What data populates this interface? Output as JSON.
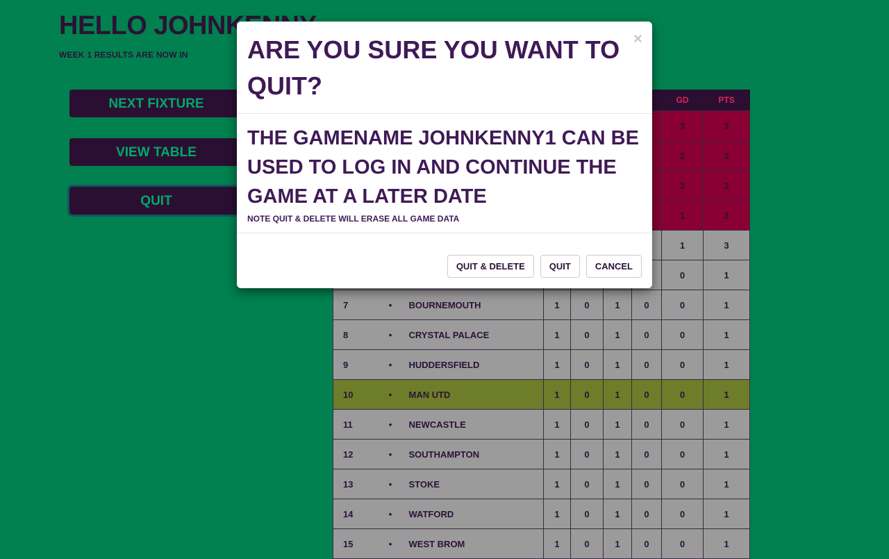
{
  "header": {
    "greeting": "HELLO JOHNKENNY",
    "subtitle": "WEEK 1 RESULTS ARE NOW IN"
  },
  "menu": {
    "next_fixture": "NEXT FIXTURE",
    "view_table": "VIEW TABLE",
    "quit": "QUIT"
  },
  "table": {
    "visible_headers": [
      "GD",
      "PTS"
    ],
    "rows": [
      {
        "pos": "",
        "dot": "",
        "team": "",
        "p": "",
        "w": "",
        "d": "",
        "l": "",
        "gd": "3",
        "pts": "3",
        "style": "top"
      },
      {
        "pos": "",
        "dot": "",
        "team": "",
        "p": "",
        "w": "",
        "d": "",
        "l": "",
        "gd": "2",
        "pts": "3",
        "style": "top"
      },
      {
        "pos": "",
        "dot": "",
        "team": "",
        "p": "",
        "w": "",
        "d": "",
        "l": "",
        "gd": "2",
        "pts": "3",
        "style": "top"
      },
      {
        "pos": "",
        "dot": "",
        "team": "",
        "p": "",
        "w": "",
        "d": "",
        "l": "",
        "gd": "1",
        "pts": "3",
        "style": "top"
      },
      {
        "pos": "",
        "dot": "",
        "team": "",
        "p": "",
        "w": "",
        "d": "",
        "l": "",
        "gd": "1",
        "pts": "3",
        "style": "mid"
      },
      {
        "pos": "",
        "dot": "",
        "team": "",
        "p": "",
        "w": "",
        "d": "",
        "l": "",
        "gd": "0",
        "pts": "1",
        "style": "mid"
      },
      {
        "pos": "7",
        "dot": "•",
        "team": "BOURNEMOUTH",
        "p": "1",
        "w": "0",
        "d": "1",
        "l": "0",
        "gd": "0",
        "pts": "1",
        "style": "mid"
      },
      {
        "pos": "8",
        "dot": "•",
        "team": "CRYSTAL PALACE",
        "p": "1",
        "w": "0",
        "d": "1",
        "l": "0",
        "gd": "0",
        "pts": "1",
        "style": "mid"
      },
      {
        "pos": "9",
        "dot": "•",
        "team": "HUDDERSFIELD",
        "p": "1",
        "w": "0",
        "d": "1",
        "l": "0",
        "gd": "0",
        "pts": "1",
        "style": "mid"
      },
      {
        "pos": "10",
        "dot": "•",
        "team": "MAN UTD",
        "p": "1",
        "w": "0",
        "d": "1",
        "l": "0",
        "gd": "0",
        "pts": "1",
        "style": "hl"
      },
      {
        "pos": "11",
        "dot": "•",
        "team": "NEWCASTLE",
        "p": "1",
        "w": "0",
        "d": "1",
        "l": "0",
        "gd": "0",
        "pts": "1",
        "style": "mid"
      },
      {
        "pos": "12",
        "dot": "•",
        "team": "SOUTHAMPTON",
        "p": "1",
        "w": "0",
        "d": "1",
        "l": "0",
        "gd": "0",
        "pts": "1",
        "style": "mid"
      },
      {
        "pos": "13",
        "dot": "•",
        "team": "STOKE",
        "p": "1",
        "w": "0",
        "d": "1",
        "l": "0",
        "gd": "0",
        "pts": "1",
        "style": "mid"
      },
      {
        "pos": "14",
        "dot": "•",
        "team": "WATFORD",
        "p": "1",
        "w": "0",
        "d": "1",
        "l": "0",
        "gd": "0",
        "pts": "1",
        "style": "mid"
      },
      {
        "pos": "15",
        "dot": "•",
        "team": "WEST BROM",
        "p": "1",
        "w": "0",
        "d": "1",
        "l": "0",
        "gd": "0",
        "pts": "1",
        "style": "mid"
      }
    ]
  },
  "modal": {
    "close_glyph": "×",
    "title": "ARE YOU SURE YOU WANT TO QUIT?",
    "body_main": "THE GAMENAME JOHNKENNY1 CAN BE USED TO LOG IN AND CONTINUE THE GAME AT A LATER DATE",
    "body_note": "NOTE QUIT & DELETE WILL ERASE ALL GAME DATA",
    "buttons": {
      "quit_delete": "QUIT & DELETE",
      "quit": "QUIT",
      "cancel": "CANCEL"
    }
  },
  "colors": {
    "background": "#00814f",
    "button_bg": "#2b0f32",
    "button_text": "#00a86b",
    "top_rows": "#8a0034",
    "highlight_row": "#6e7d2a",
    "mid_rows": "#9b9b9b",
    "modal_text": "#3f1a56"
  }
}
